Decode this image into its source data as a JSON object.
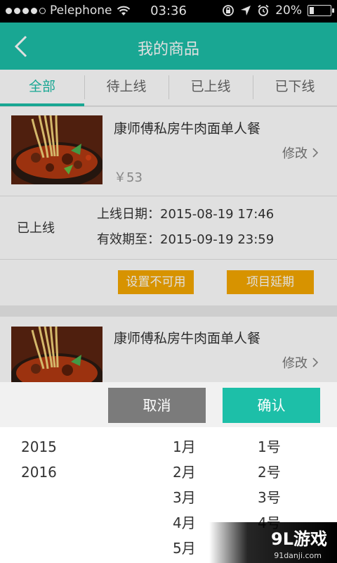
{
  "status_bar": {
    "carrier": "Pelephone",
    "time": "03:36",
    "battery": "20%",
    "battery_level": 0.2,
    "signal_dots": 5,
    "signal_filled": 4
  },
  "nav": {
    "title": "我的商品",
    "back_icon": "chevron-left-icon"
  },
  "tabs": [
    {
      "label": "全部",
      "active": true
    },
    {
      "label": "待上线",
      "active": false
    },
    {
      "label": "已上线",
      "active": false
    },
    {
      "label": "已下线",
      "active": false
    }
  ],
  "products": [
    {
      "title": "康师傅私房牛肉面单人餐",
      "edit_label": "修改",
      "price": "￥53",
      "status": "已上线",
      "online_date": "上线日期：2015-08-19 17:46",
      "valid_until": "有效期至：2015-09-19 23:59",
      "actions": [
        "设置不可用",
        "项目延期"
      ]
    },
    {
      "title": "康师傅私房牛肉面单人餐",
      "edit_label": "修改"
    }
  ],
  "picker": {
    "cancel_label": "取消",
    "confirm_label": "确认",
    "years": [
      "2015",
      "2016"
    ],
    "months": [
      "1月",
      "2月",
      "3月",
      "4月",
      "5月"
    ],
    "days": [
      "1号",
      "2号",
      "3号",
      "4号"
    ]
  },
  "watermark": {
    "logo": "9L游戏",
    "url": "91danji.com"
  },
  "colors": {
    "accent": "#1dbfa8",
    "action": "#f5a800",
    "cancel": "#7b7b7b"
  }
}
